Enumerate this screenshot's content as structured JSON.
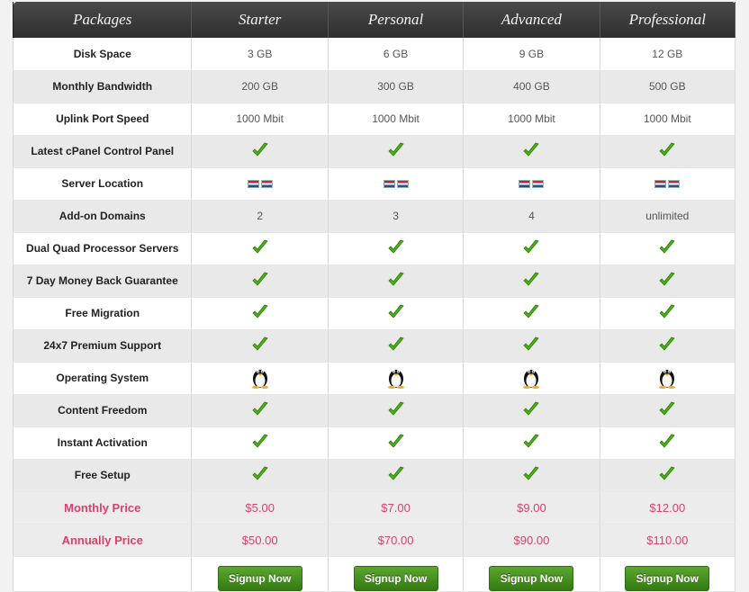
{
  "header": {
    "packages_label": "Packages",
    "plans": [
      "Starter",
      "Personal",
      "Advanced",
      "Professional"
    ]
  },
  "features": [
    {
      "label": "Disk Space",
      "type": "text",
      "values": [
        "3 GB",
        "6 GB",
        "9 GB",
        "12 GB"
      ]
    },
    {
      "label": "Monthly Bandwidth",
      "type": "text",
      "values": [
        "200 GB",
        "300 GB",
        "400 GB",
        "500 GB"
      ]
    },
    {
      "label": "Uplink Port Speed",
      "type": "text",
      "values": [
        "1000 Mbit",
        "1000 Mbit",
        "1000 Mbit",
        "1000 Mbit"
      ]
    },
    {
      "label": "Latest cPanel Control Panel",
      "type": "check-icon"
    },
    {
      "label": "Server Location",
      "type": "flag-icon"
    },
    {
      "label": "Add-on Domains",
      "type": "text",
      "values": [
        "2",
        "3",
        "4",
        "unlimited"
      ]
    },
    {
      "label": "Dual Quad Processor Servers",
      "type": "check-icon"
    },
    {
      "label": "7 Day Money Back Guarantee",
      "type": "check-icon"
    },
    {
      "label": "Free Migration",
      "type": "check-icon"
    },
    {
      "label": "24x7 Premium Support",
      "type": "check-icon"
    },
    {
      "label": "Operating System",
      "type": "linux-tux-icon"
    },
    {
      "label": "Content Freedom",
      "type": "check-icon"
    },
    {
      "label": "Instant Activation",
      "type": "check-icon"
    },
    {
      "label": "Free Setup",
      "type": "check-icon"
    }
  ],
  "pricing": {
    "monthly": {
      "label": "Monthly Price",
      "values": [
        "$5.00",
        "$7.00",
        "$9.00",
        "$12.00"
      ]
    },
    "annually": {
      "label": "Annually Price",
      "values": [
        "$50.00",
        "$70.00",
        "$90.00",
        "$110.00"
      ]
    }
  },
  "signup_label": "Signup Now",
  "colors": {
    "header_bg": "#3a3a3a",
    "price_text": "#d6436b",
    "check_green": "#4caf1a",
    "button_green": "#4a9322"
  }
}
